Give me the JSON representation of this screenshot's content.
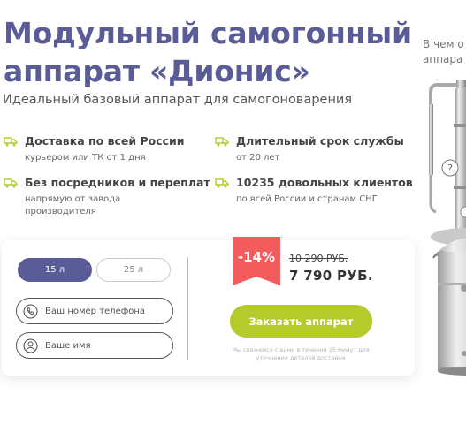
{
  "header": {
    "title": "Модульный самогонный аппарат «Дионис»",
    "subtitle": "Идеальный базовый аппарат для самогоноварения"
  },
  "features": [
    {
      "icon": "truck-icon",
      "title": "Доставка по всей России",
      "subtitle": "курьером или ТК от 1 дня"
    },
    {
      "icon": "truck-icon",
      "title": "Длительный срок службы",
      "subtitle": "от 20 лет"
    },
    {
      "icon": "truck-icon",
      "title": "Без посредников и переплат",
      "subtitle": "напрямую от завода производителя"
    },
    {
      "icon": "truck-icon",
      "title": "10235 довольных клиентов",
      "subtitle": "по всей России и странам СНГ"
    }
  ],
  "order_form": {
    "volume_options": [
      "15 л",
      "25 л"
    ],
    "selected_volume": "15 л",
    "phone_placeholder": "Ваш номер телефона",
    "name_placeholder": "Ваше имя",
    "discount": "-14%",
    "old_price": "10 290 РУБ.",
    "new_price": "7 790 РУБ.",
    "order_button": "Заказать аппарат",
    "note": "Мы свяжемся с вами в течении 15 минут для уточнения деталей доставки"
  },
  "side": {
    "text_line1": "В чем о",
    "text_line2": "аппара",
    "help_marker": "?"
  },
  "colors": {
    "title": "#5a5c98",
    "accent_green": "#b5cb2c",
    "badge_red": "#f25c5c",
    "volume_active": "#5a5c98"
  }
}
